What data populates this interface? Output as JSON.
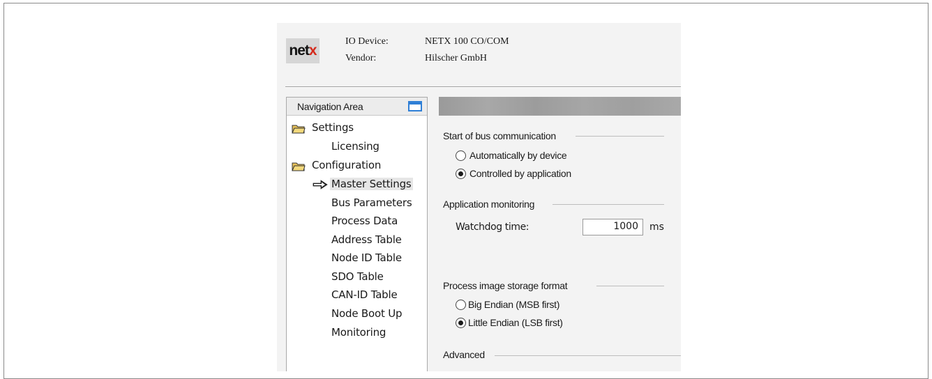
{
  "header": {
    "logo_text": "net",
    "logo_mark": "x",
    "io_device_label": "IO Device:",
    "io_device_value": "NETX 100 CO/COM",
    "vendor_label": "Vendor:",
    "vendor_value": "Hilscher GmbH"
  },
  "navigation": {
    "title": "Navigation Area",
    "window_icon": "window-icon",
    "items": [
      {
        "label": "Settings",
        "icon": "folder-icon"
      },
      {
        "label": "Licensing"
      },
      {
        "label": "Configuration",
        "icon": "folder-icon"
      },
      {
        "label": "Master Settings",
        "icon": "arrow-right-icon",
        "selected": true
      },
      {
        "label": "Bus Parameters"
      },
      {
        "label": "Process Data"
      },
      {
        "label": "Address Table"
      },
      {
        "label": "Node ID Table"
      },
      {
        "label": "SDO Table"
      },
      {
        "label": "CAN-ID Table"
      },
      {
        "label": "Node Boot Up"
      },
      {
        "label": "Monitoring"
      }
    ]
  },
  "content": {
    "bus_start": {
      "title": "Start of bus communication",
      "options": [
        "Automatically by device",
        "Controlled by application"
      ],
      "selected": "Controlled by application"
    },
    "app_monitoring": {
      "title": "Application monitoring",
      "watchdog_label": "Watchdog time:",
      "watchdog_value": "1000",
      "watchdog_unit": "ms"
    },
    "storage_format": {
      "title": "Process image storage format",
      "options": [
        "Big Endian (MSB first)",
        "Little Endian (LSB first)"
      ],
      "selected": "Little Endian (LSB first)"
    },
    "advanced": {
      "title": "Advanced"
    }
  },
  "colors": {
    "logo_accent": "#d42a1c",
    "window_icon": "#2f7fd6",
    "panel_bg": "#f3f3f3"
  }
}
